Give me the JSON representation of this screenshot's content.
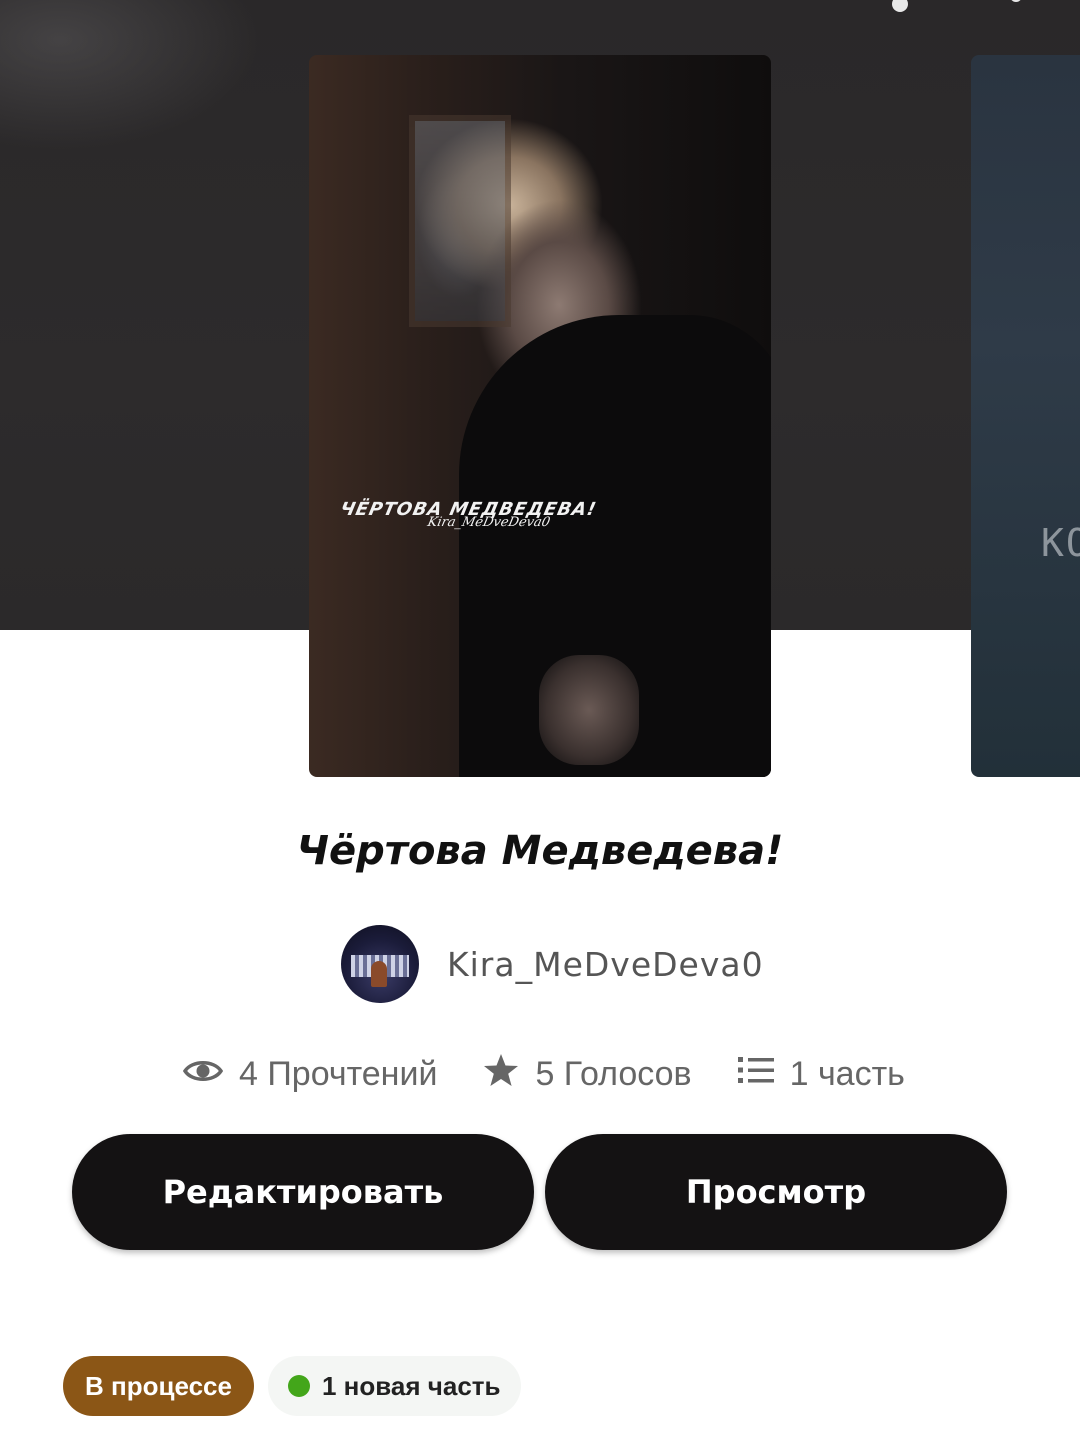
{
  "story": {
    "cover_caption": "ЧЁРТОВА МЕДВЕДЕВА!",
    "cover_signature": "Kira_MeDveDeva0",
    "next_cover_text": "КО",
    "title": "Чёртова Медведева!",
    "author": "Kira_MeDveDeva0"
  },
  "stats": {
    "reads": "4 Прочтений",
    "votes": "5 Голосов",
    "parts": "1 часть"
  },
  "actions": {
    "edit_label": "Редактировать",
    "view_label": "Просмотр"
  },
  "badges": {
    "status": "В процессе",
    "new_parts": "1 новая часть"
  },
  "colors": {
    "header_bg": "#2b292a",
    "button_bg": "#141213",
    "status_badge": "#8b5616",
    "new_dot": "#43a61a"
  },
  "icons": {
    "reads": "eye-icon",
    "votes": "star-icon",
    "parts": "list-icon"
  }
}
